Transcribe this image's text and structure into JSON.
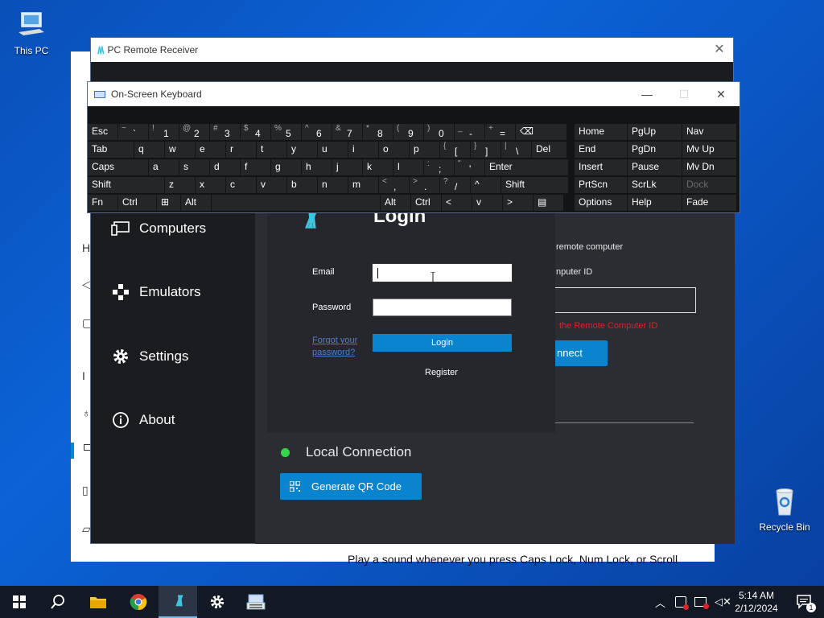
{
  "desktop": {
    "this_pc_label": "This PC",
    "recycle_bin_label": "Recycle Bin"
  },
  "settings_window": {
    "bottom_text": "Play a sound whenever you press Caps Lock, Num Lock, or Scroll",
    "side_glyphs": [
      "H",
      "I"
    ]
  },
  "pc_remote": {
    "title": "PC Remote Receiver",
    "nav": [
      "Computers",
      "Emulators",
      "Settings",
      "About"
    ],
    "remote_computer_label": "remote computer",
    "computer_id_label": "nputer ID",
    "computer_id_error": "the Remote Computer ID",
    "connect_label": "nnect",
    "local_connection_label": "Local Connection",
    "generate_qr_label": "Generate QR Code"
  },
  "login_dialog": {
    "title": "Login",
    "email_label": "Email",
    "email_value": "",
    "password_label": "Password",
    "password_value": "",
    "forgot_label": "Forgot your password?",
    "login_button": "Login",
    "register_label": "Register"
  },
  "keyboard": {
    "title": "On-Screen Keyboard",
    "rows": [
      [
        {
          "l": "Esc"
        },
        {
          "s": "~",
          "l": "`"
        },
        {
          "s": "!",
          "l": "1"
        },
        {
          "s": "@",
          "l": "2"
        },
        {
          "s": "#",
          "l": "3"
        },
        {
          "s": "$",
          "l": "4"
        },
        {
          "s": "%",
          "l": "5"
        },
        {
          "s": "^",
          "l": "6"
        },
        {
          "s": "&",
          "l": "7"
        },
        {
          "s": "*",
          "l": "8"
        },
        {
          "s": "(",
          "l": "9"
        },
        {
          "s": ")",
          "l": "0"
        },
        {
          "s": "_",
          "l": "-"
        },
        {
          "s": "+",
          "l": "="
        },
        {
          "l": "⌫"
        },
        {
          "l": "Home"
        },
        {
          "l": "PgUp"
        },
        {
          "l": "Nav"
        }
      ],
      [
        {
          "l": "Tab"
        },
        {
          "l": "q"
        },
        {
          "l": "w"
        },
        {
          "l": "e"
        },
        {
          "l": "r"
        },
        {
          "l": "t"
        },
        {
          "l": "y"
        },
        {
          "l": "u"
        },
        {
          "l": "i"
        },
        {
          "l": "o"
        },
        {
          "l": "p"
        },
        {
          "s": "{",
          "l": "["
        },
        {
          "s": "}",
          "l": "]"
        },
        {
          "s": "|",
          "l": "\\"
        },
        {
          "l": "Del"
        },
        {
          "l": "End"
        },
        {
          "l": "PgDn"
        },
        {
          "l": "Mv Up"
        }
      ],
      [
        {
          "l": "Caps"
        },
        {
          "l": "a"
        },
        {
          "l": "s"
        },
        {
          "l": "d"
        },
        {
          "l": "f"
        },
        {
          "l": "g"
        },
        {
          "l": "h"
        },
        {
          "l": "j"
        },
        {
          "l": "k"
        },
        {
          "l": "l"
        },
        {
          "s": ":",
          "l": ";"
        },
        {
          "s": "\"",
          "l": "'"
        },
        {
          "l": "Enter"
        },
        {
          "l": "Insert"
        },
        {
          "l": "Pause"
        },
        {
          "l": "Mv Dn"
        }
      ],
      [
        {
          "l": "Shift"
        },
        {
          "l": "z"
        },
        {
          "l": "x"
        },
        {
          "l": "c"
        },
        {
          "l": "v"
        },
        {
          "l": "b"
        },
        {
          "l": "n"
        },
        {
          "l": "m"
        },
        {
          "s": "<",
          "l": ","
        },
        {
          "s": ">",
          "l": "."
        },
        {
          "s": "?",
          "l": "/"
        },
        {
          "l": "^"
        },
        {
          "l": "Shift"
        },
        {
          "l": "PrtScn"
        },
        {
          "l": "ScrLk"
        },
        {
          "l": "Dock"
        }
      ],
      [
        {
          "l": "Fn"
        },
        {
          "l": "Ctrl"
        },
        {
          "l": "⊞"
        },
        {
          "l": "Alt"
        },
        {
          "l": ""
        },
        {
          "l": "Alt"
        },
        {
          "l": "Ctrl"
        },
        {
          "l": "<"
        },
        {
          "l": "v"
        },
        {
          "l": ">"
        },
        {
          "l": "▤"
        },
        {
          "l": "Options"
        },
        {
          "l": "Help"
        },
        {
          "l": "Fade"
        }
      ]
    ]
  },
  "taskbar": {
    "time": "5:14 AM",
    "date": "2/12/2024",
    "notification_count": "1"
  },
  "colors": {
    "accent": "#0a84cf",
    "brand": "#3cc6e0",
    "status_online": "#32d84a",
    "error": "#e0202a"
  }
}
